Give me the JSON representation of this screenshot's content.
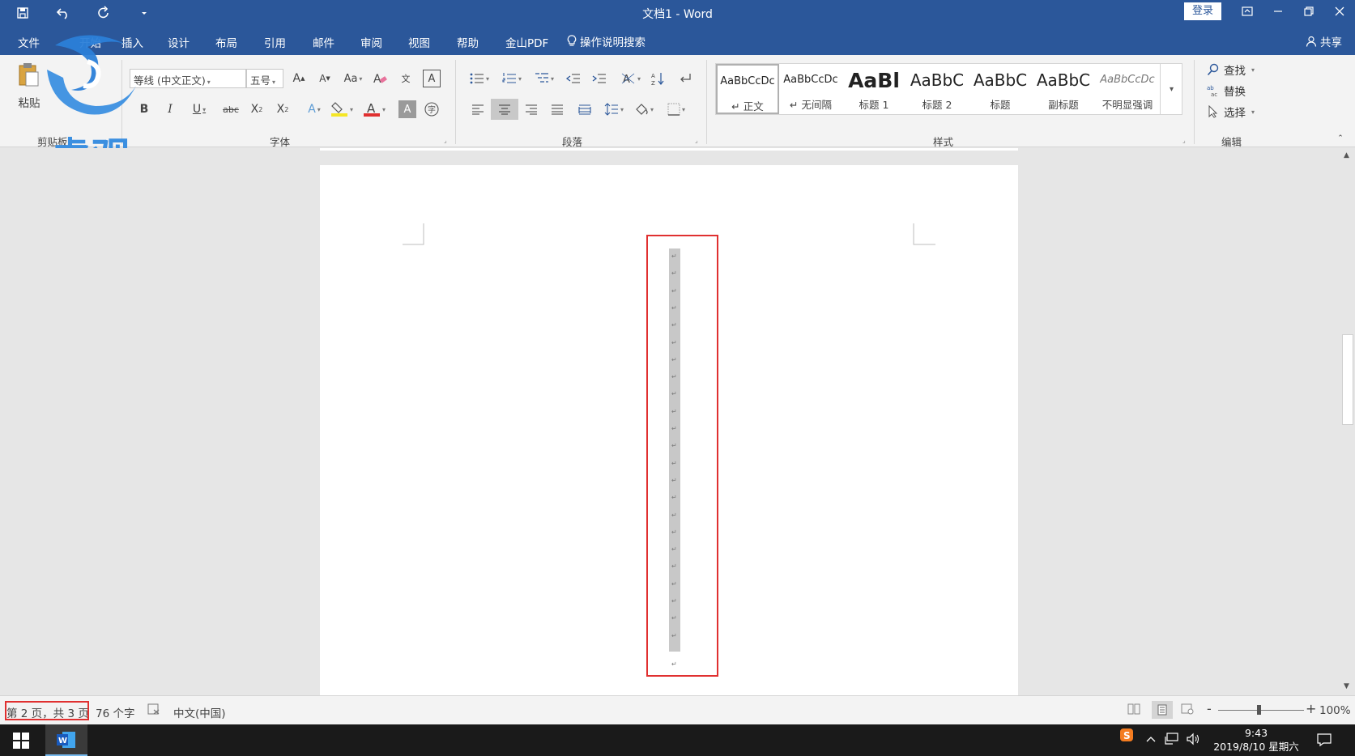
{
  "title_bar": {
    "document_title": "文档1 - Word",
    "login_label": "登录",
    "qat_icons": [
      "save-icon",
      "undo-icon",
      "redo-icon",
      "customize-icon"
    ],
    "window_icons": [
      "ribbon-display-icon",
      "minimize-icon",
      "restore-icon",
      "close-icon"
    ]
  },
  "menu": {
    "tabs": [
      "文件",
      "开始",
      "插入",
      "设计",
      "布局",
      "引用",
      "邮件",
      "审阅",
      "视图",
      "帮助",
      "金山PDF"
    ],
    "tell_me": "操作说明搜索",
    "share": "共享"
  },
  "ribbon": {
    "clipboard": {
      "paste_label": "粘贴",
      "group_label": "剪贴板"
    },
    "font": {
      "font_name": "等线 (中文正文)",
      "font_size": "五号",
      "group_label": "字体",
      "colors": {
        "highlight": "#f5e625",
        "font_color": "#e03030"
      }
    },
    "paragraph": {
      "group_label": "段落"
    },
    "styles": {
      "group_label": "样式",
      "items": [
        {
          "preview": "AaBbCcDc",
          "label": "↵ 正文",
          "selected": true
        },
        {
          "preview": "AaBbCcDc",
          "label": "↵ 无间隔",
          "selected": false
        },
        {
          "preview": "AaBl",
          "label": "标题 1",
          "selected": false
        },
        {
          "preview": "AaBbC",
          "label": "标题 2",
          "selected": false
        },
        {
          "preview": "AaBbC",
          "label": "标题",
          "selected": false
        },
        {
          "preview": "AaBbC",
          "label": "副标题",
          "selected": false
        },
        {
          "preview": "AaBbCcDc",
          "label": "不明显强调",
          "selected": false
        }
      ]
    },
    "editing": {
      "find": "查找",
      "replace": "替换",
      "select": "选择",
      "group_label": "编辑"
    }
  },
  "logo": {
    "text": "虎观"
  },
  "document": {
    "paragraph_mark": "↵",
    "highlight_color": "#e03030"
  },
  "status_bar": {
    "page_info": "第 2 页，共 3 页",
    "word_count": "76 个字",
    "language": "中文(中国)",
    "zoom": "100%",
    "zoom_minus": "-",
    "zoom_plus": "+"
  },
  "taskbar": {
    "time": "9:43",
    "date": "2019/8/10 星期六"
  }
}
